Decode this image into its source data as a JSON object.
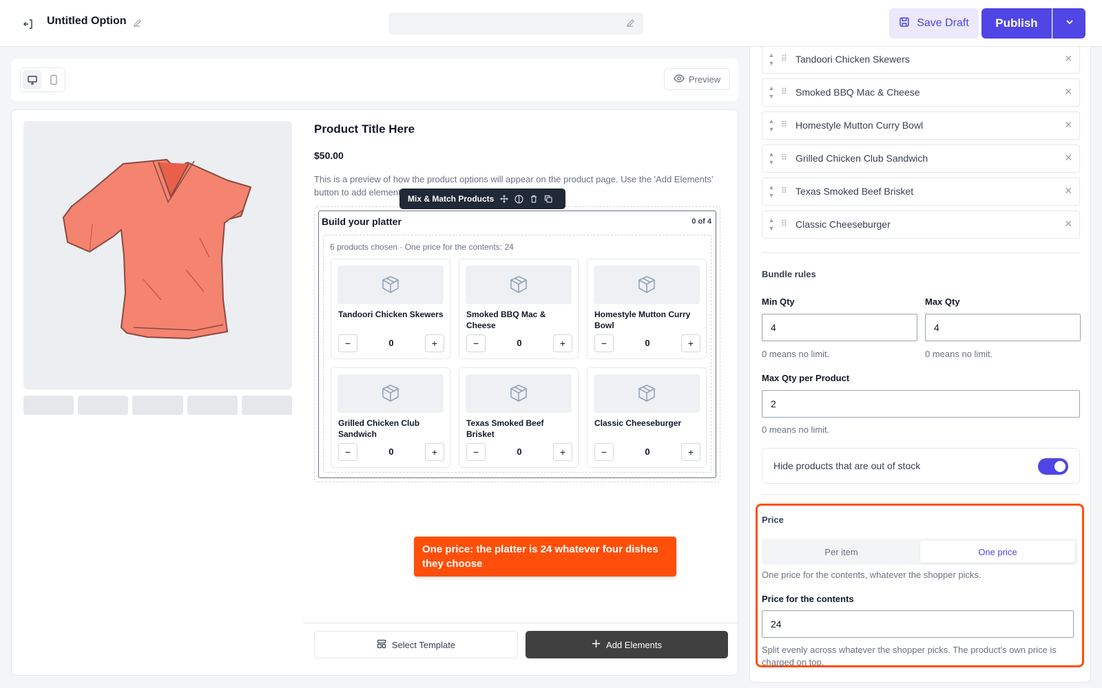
{
  "header": {
    "title": "Untitled Option",
    "name_placeholder": "",
    "save_draft_label": "Save Draft",
    "publish_label": "Publish"
  },
  "toolbar": {
    "preview_label": "Preview"
  },
  "product": {
    "title": "Product Title Here",
    "price": "$50.00",
    "description": "This is a preview of how the product options will appear on the product page. Use the 'Add Elements' button to add elements and configure their settings."
  },
  "element_toolbar": {
    "label": "Mix & Match Products"
  },
  "platter": {
    "title": "Build your platter",
    "count": "0 of 4",
    "chosen_note": "6 products chosen · One price for the contents: 24",
    "products": [
      {
        "name": "Tandoori Chicken Skewers",
        "qty": "0"
      },
      {
        "name": "Smoked BBQ Mac & Cheese",
        "qty": "0"
      },
      {
        "name": "Homestyle Mutton Curry Bowl",
        "qty": "0"
      },
      {
        "name": "Grilled Chicken Club Sandwich",
        "qty": "0"
      },
      {
        "name": "Texas Smoked Beef Brisket",
        "qty": "0"
      },
      {
        "name": "Classic Cheeseburger",
        "qty": "0"
      }
    ]
  },
  "callout": "One price: the platter is 24 whatever four dishes they choose",
  "footer": {
    "select_template_label": "Select Template",
    "add_elements_label": "Add Elements"
  },
  "panel": {
    "items": [
      {
        "label": "Tandoori Chicken Skewers"
      },
      {
        "label": "Smoked BBQ Mac & Cheese"
      },
      {
        "label": "Homestyle Mutton Curry Bowl"
      },
      {
        "label": "Grilled Chicken Club Sandwich"
      },
      {
        "label": "Texas Smoked Beef Brisket"
      },
      {
        "label": "Classic Cheeseburger"
      }
    ],
    "bundle_rules": {
      "heading": "Bundle rules",
      "min_qty_label": "Min Qty",
      "min_qty_value": "4",
      "max_qty_label": "Max Qty",
      "max_qty_value": "4",
      "max_per_product_label": "Max Qty per Product",
      "max_per_product_value": "2",
      "hint": "0 means no limit."
    },
    "hide_oos_label": "Hide products that are out of stock",
    "hide_oos_enabled": true,
    "price": {
      "heading": "Price",
      "options": [
        "Per item",
        "One price"
      ],
      "selected": "One price",
      "description": "One price for the contents, whatever the shopper picks.",
      "contents_label": "Price for the contents",
      "contents_value": "24",
      "contents_hint": "Split evenly across whatever the shopper picks. The product's own price is charged on top."
    }
  },
  "colors": {
    "accent": "#4f46e5",
    "highlight": "#ff4f0a"
  }
}
